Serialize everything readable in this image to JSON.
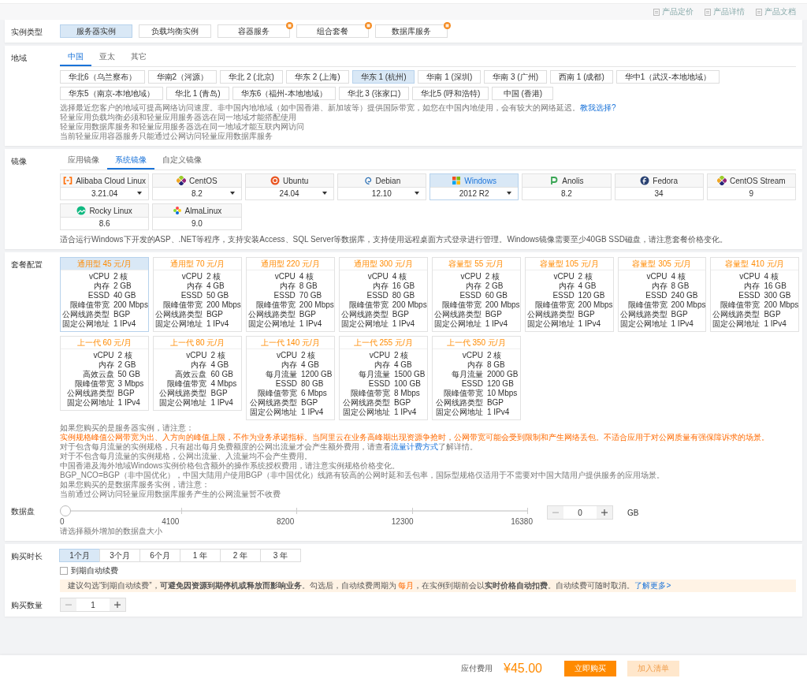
{
  "toolbar": {
    "links": [
      "产品定价",
      "产品详情",
      "产品文档"
    ]
  },
  "instance_type": {
    "label": "实例类型",
    "options": [
      {
        "label": "服务器实例",
        "selected": true,
        "badge": false
      },
      {
        "label": "负载均衡实例",
        "selected": false,
        "badge": false
      },
      {
        "label": "容器服务",
        "selected": false,
        "badge": true
      },
      {
        "label": "组合套餐",
        "selected": false,
        "badge": true
      },
      {
        "label": "数据库服务",
        "selected": false,
        "badge": true
      }
    ]
  },
  "region": {
    "label": "地域",
    "tabs": [
      {
        "label": "中国",
        "selected": true
      },
      {
        "label": "亚太",
        "selected": false
      },
      {
        "label": "其它",
        "selected": false
      }
    ],
    "options": [
      {
        "label": "华北6（乌兰察布）",
        "selected": false
      },
      {
        "label": "华南2（河源）",
        "selected": false
      },
      {
        "label": "华北 2 (北京)",
        "selected": false
      },
      {
        "label": "华东 2 (上海)",
        "selected": false
      },
      {
        "label": "华东 1 (杭州)",
        "selected": true
      },
      {
        "label": "华南 1 (深圳)",
        "selected": false
      },
      {
        "label": "华南 3 (广州)",
        "selected": false
      },
      {
        "label": "西南 1 (成都)",
        "selected": false
      },
      {
        "label": "华中1（武汉-本地地域）",
        "selected": false
      },
      {
        "label": "华东5（南京-本地地域）",
        "selected": false
      },
      {
        "label": "华北 1 (青岛)",
        "selected": false
      },
      {
        "label": "华东6（福州-本地地域）",
        "selected": false
      },
      {
        "label": "华北 3 (张家口)",
        "selected": false
      },
      {
        "label": "华北5 (呼和浩特)",
        "selected": false
      },
      {
        "label": "中国 (香港)",
        "selected": false
      }
    ],
    "notes": [
      {
        "text": "选择最近您客户的地域可提高网络访问速度。非中国内地地域（如中国香港、新加坡等）提供国际带宽，如您在中国内地使用，会有较大的网络延迟。",
        "link": "教我选择?"
      },
      {
        "text": "轻量应用负载均衡必须和轻量应用服务器选在同一地域才能搭配使用"
      },
      {
        "text": "轻量应用数据库服务和轻量应用服务器选在同一地域才能互联内网访问"
      },
      {
        "text": "当前轻量应用容器服务只能通过公网访问轻量应用数据库服务"
      }
    ]
  },
  "image": {
    "label": "镜像",
    "tabs": [
      {
        "label": "应用镜像",
        "selected": false
      },
      {
        "label": "系统镜像",
        "selected": true
      },
      {
        "label": "自定义镜像",
        "selected": false
      }
    ],
    "options": [
      {
        "kind": "alinux",
        "name": "Alibaba Cloud Linux",
        "version": "3.21.04",
        "dropdown": true,
        "selected": false
      },
      {
        "kind": "centos",
        "name": "CentOS",
        "version": "8.2",
        "dropdown": true,
        "selected": false
      },
      {
        "kind": "ubuntu",
        "name": "Ubuntu",
        "version": "24.04",
        "dropdown": true,
        "selected": false
      },
      {
        "kind": "debian",
        "name": "Debian",
        "version": "12.10",
        "dropdown": true,
        "selected": false
      },
      {
        "kind": "windows",
        "name": "Windows",
        "version": "2012 R2",
        "dropdown": true,
        "selected": true
      },
      {
        "kind": "anolis",
        "name": "Anolis",
        "version": "8.2",
        "dropdown": false,
        "selected": false
      },
      {
        "kind": "fedora",
        "name": "Fedora",
        "version": "34",
        "dropdown": false,
        "selected": false
      },
      {
        "kind": "centos",
        "name": "CentOS Stream",
        "version": "9",
        "dropdown": false,
        "selected": false
      },
      {
        "kind": "rocky",
        "name": "Rocky Linux",
        "version": "8.6",
        "dropdown": false,
        "selected": false
      },
      {
        "kind": "alma",
        "name": "AlmaLinux",
        "version": "9.0",
        "dropdown": false,
        "selected": false
      }
    ],
    "description": "适合运行Windows下开发的ASP、.NET等程序，支持安装Access、SQL Server等数据库，支持使用远程桌面方式登录进行管理。Windows镜像需要至少40GB SSD磁盘，请注意套餐价格变化。"
  },
  "plan": {
    "label": "套餐配置",
    "plans": [
      {
        "title": "通用型 45 元/月",
        "selected": true,
        "specs": [
          {
            "label": "vCPU",
            "value": "2 核"
          },
          {
            "label": "内存",
            "value": "2 GB"
          },
          {
            "label": "ESSD",
            "value": "40 GB"
          },
          {
            "label": "限峰值带宽",
            "value": "200 Mbps"
          },
          {
            "label": "公网线路类型",
            "value": "BGP"
          },
          {
            "label": "固定公网地址",
            "value": "1 IPv4"
          }
        ]
      },
      {
        "title": "通用型 70 元/月",
        "selected": false,
        "specs": [
          {
            "label": "vCPU",
            "value": "2 核"
          },
          {
            "label": "内存",
            "value": "4 GB"
          },
          {
            "label": "ESSD",
            "value": "50 GB"
          },
          {
            "label": "限峰值带宽",
            "value": "200 Mbps"
          },
          {
            "label": "公网线路类型",
            "value": "BGP"
          },
          {
            "label": "固定公网地址",
            "value": "1 IPv4"
          }
        ]
      },
      {
        "title": "通用型 220 元/月",
        "selected": false,
        "specs": [
          {
            "label": "vCPU",
            "value": "4 核"
          },
          {
            "label": "内存",
            "value": "8 GB"
          },
          {
            "label": "ESSD",
            "value": "70 GB"
          },
          {
            "label": "限峰值带宽",
            "value": "200 Mbps"
          },
          {
            "label": "公网线路类型",
            "value": "BGP"
          },
          {
            "label": "固定公网地址",
            "value": "1 IPv4"
          }
        ]
      },
      {
        "title": "通用型 300 元/月",
        "selected": false,
        "specs": [
          {
            "label": "vCPU",
            "value": "4 核"
          },
          {
            "label": "内存",
            "value": "16 GB"
          },
          {
            "label": "ESSD",
            "value": "80 GB"
          },
          {
            "label": "限峰值带宽",
            "value": "200 Mbps"
          },
          {
            "label": "公网线路类型",
            "value": "BGP"
          },
          {
            "label": "固定公网地址",
            "value": "1 IPv4"
          }
        ]
      },
      {
        "title": "容量型 55 元/月",
        "selected": false,
        "specs": [
          {
            "label": "vCPU",
            "value": "2 核"
          },
          {
            "label": "内存",
            "value": "2 GB"
          },
          {
            "label": "ESSD",
            "value": "60 GB"
          },
          {
            "label": "限峰值带宽",
            "value": "200 Mbps"
          },
          {
            "label": "公网线路类型",
            "value": "BGP"
          },
          {
            "label": "固定公网地址",
            "value": "1 IPv4"
          }
        ]
      },
      {
        "title": "容量型 105 元/月",
        "selected": false,
        "specs": [
          {
            "label": "vCPU",
            "value": "2 核"
          },
          {
            "label": "内存",
            "value": "4 GB"
          },
          {
            "label": "ESSD",
            "value": "120 GB"
          },
          {
            "label": "限峰值带宽",
            "value": "200 Mbps"
          },
          {
            "label": "公网线路类型",
            "value": "BGP"
          },
          {
            "label": "固定公网地址",
            "value": "1 IPv4"
          }
        ]
      },
      {
        "title": "容量型 305 元/月",
        "selected": false,
        "specs": [
          {
            "label": "vCPU",
            "value": "4 核"
          },
          {
            "label": "内存",
            "value": "8 GB"
          },
          {
            "label": "ESSD",
            "value": "240 GB"
          },
          {
            "label": "限峰值带宽",
            "value": "200 Mbps"
          },
          {
            "label": "公网线路类型",
            "value": "BGP"
          },
          {
            "label": "固定公网地址",
            "value": "1 IPv4"
          }
        ]
      },
      {
        "title": "容量型 410 元/月",
        "selected": false,
        "specs": [
          {
            "label": "vCPU",
            "value": "4 核"
          },
          {
            "label": "内存",
            "value": "16 GB"
          },
          {
            "label": "ESSD",
            "value": "300 GB"
          },
          {
            "label": "限峰值带宽",
            "value": "200 Mbps"
          },
          {
            "label": "公网线路类型",
            "value": "BGP"
          },
          {
            "label": "固定公网地址",
            "value": "1 IPv4"
          }
        ]
      },
      {
        "title": "上一代 60 元/月",
        "selected": false,
        "specs": [
          {
            "label": "vCPU",
            "value": "2 核"
          },
          {
            "label": "内存",
            "value": "2 GB"
          },
          {
            "label": "高效云盘",
            "value": "50 GB"
          },
          {
            "label": "限峰值带宽",
            "value": "3 Mbps"
          },
          {
            "label": "公网线路类型",
            "value": "BGP"
          },
          {
            "label": "固定公网地址",
            "value": "1 IPv4"
          }
        ]
      },
      {
        "title": "上一代 80 元/月",
        "selected": false,
        "specs": [
          {
            "label": "vCPU",
            "value": "2 核"
          },
          {
            "label": "内存",
            "value": "4 GB"
          },
          {
            "label": "高效云盘",
            "value": "60 GB"
          },
          {
            "label": "限峰值带宽",
            "value": "4 Mbps"
          },
          {
            "label": "公网线路类型",
            "value": "BGP"
          },
          {
            "label": "固定公网地址",
            "value": "1 IPv4"
          }
        ]
      },
      {
        "title": "上一代 140 元/月",
        "selected": false,
        "specs": [
          {
            "label": "vCPU",
            "value": "2 核"
          },
          {
            "label": "内存",
            "value": "4 GB"
          },
          {
            "label": "每月流量",
            "value": "1200 GB"
          },
          {
            "label": "ESSD",
            "value": "80 GB"
          },
          {
            "label": "限峰值带宽",
            "value": "6 Mbps"
          },
          {
            "label": "公网线路类型",
            "value": "BGP"
          },
          {
            "label": "固定公网地址",
            "value": "1 IPv4"
          }
        ]
      },
      {
        "title": "上一代 255 元/月",
        "selected": false,
        "specs": [
          {
            "label": "vCPU",
            "value": "2 核"
          },
          {
            "label": "内存",
            "value": "4 GB"
          },
          {
            "label": "每月流量",
            "value": "1500 GB"
          },
          {
            "label": "ESSD",
            "value": "100 GB"
          },
          {
            "label": "限峰值带宽",
            "value": "8 Mbps"
          },
          {
            "label": "公网线路类型",
            "value": "BGP"
          },
          {
            "label": "固定公网地址",
            "value": "1 IPv4"
          }
        ]
      },
      {
        "title": "上一代 350 元/月",
        "selected": false,
        "specs": [
          {
            "label": "vCPU",
            "value": "2 核"
          },
          {
            "label": "内存",
            "value": "8 GB"
          },
          {
            "label": "每月流量",
            "value": "2000 GB"
          },
          {
            "label": "ESSD",
            "value": "120 GB"
          },
          {
            "label": "限峰值带宽",
            "value": "10 Mbps"
          },
          {
            "label": "公网线路类型",
            "value": "BGP"
          },
          {
            "label": "固定公网地址",
            "value": "1 IPv4"
          }
        ]
      }
    ],
    "notes": [
      {
        "kind": "plain",
        "text": "如果您购买的是服务器实例，请注意："
      },
      {
        "kind": "warning",
        "text": "实例规格峰值公网带宽为出、入方向的峰值上限，不作为业务承诺指标。当阿里云在业务高峰期出现资源争抢时，公网带宽可能会受到限制和产生网络丢包。不适合应用于对公网质量有强保障诉求的场景。"
      },
      {
        "kind": "link",
        "text": "对于包含每月流量的实例规格，只有超出每月免费额度的公网出流量才会产生额外费用，请查看",
        "link": "流量计费方式",
        "after": "了解详情。"
      },
      {
        "kind": "plain",
        "text": "对于不包含每月流量的实例规格，公网出流量、入流量均不会产生费用。"
      },
      {
        "kind": "plain",
        "text": "中国香港及海外地域Windows实例价格包含额外的操作系统授权费用，请注意实例规格价格变化。"
      },
      {
        "kind": "plain",
        "text": "BGP_NCO=BGP（非中国优化），中国大陆用户使用BGP（非中国优化）线路有较高的公网时延和丢包率，国际型规格仅适用于不需要对中国大陆用户提供服务的应用场景。"
      },
      {
        "kind": "plain",
        "text": "如果您购买的是数据库服务实例，请注意："
      },
      {
        "kind": "plain",
        "text": "当前通过公网访问轻量应用数据库服务产生的公网流量暂不收费"
      }
    ],
    "data_disk": {
      "label": "数据盘",
      "slider": {
        "level": 0,
        "ticks": [
          "0",
          "4100",
          "8200",
          "12300",
          "16380"
        ]
      },
      "stepper": {
        "value": "0",
        "minus_disabled": true
      },
      "unit": "GB",
      "hint": "请选择额外增加的数据盘大小"
    }
  },
  "duration": {
    "label": "购买时长",
    "options": [
      {
        "label": "1个月",
        "selected": true
      },
      {
        "label": "3个月",
        "selected": false
      },
      {
        "label": "6个月",
        "selected": false
      },
      {
        "label": "1 年",
        "selected": false
      },
      {
        "label": "2 年",
        "selected": false
      },
      {
        "label": "3 年",
        "selected": false
      }
    ],
    "auto_renew": {
      "label": "到期自动续费",
      "checked": false
    },
    "tip": [
      {
        "kind": "text",
        "text": "建议勾选“到期自动续费”，**可避免因资源到期停机或释放而影响业务**。勾选后，自动续费周期为 "
      },
      {
        "kind": "highlight",
        "text": "每月"
      },
      {
        "kind": "text",
        "text": "，在实例到期前会以**实时价格自动扣费**。自动续费可随时取消。"
      },
      {
        "kind": "link",
        "text": "了解更多>"
      }
    ]
  },
  "quantity": {
    "label": "购买数量",
    "stepper": {
      "value": "1",
      "minus_disabled": true
    }
  },
  "footer": {
    "price_label": "应付费用",
    "price": "¥45.00",
    "buttons": [
      {
        "label": "立即购买",
        "kind": "primary"
      },
      {
        "label": "加入清单",
        "kind": "secondary"
      }
    ]
  }
}
